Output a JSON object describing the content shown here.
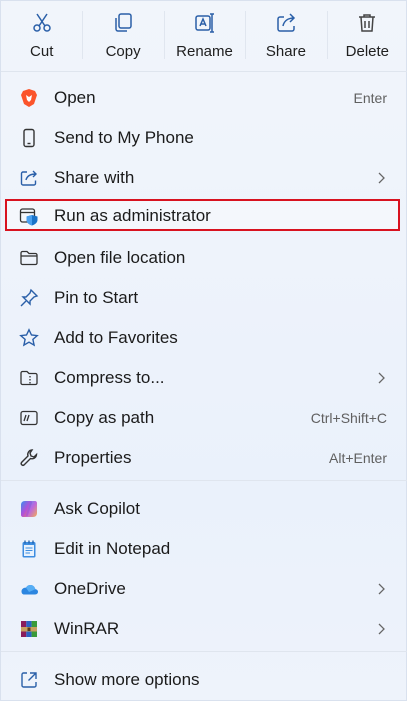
{
  "toolbar": {
    "cut": "Cut",
    "copy": "Copy",
    "rename": "Rename",
    "share": "Share",
    "delete": "Delete"
  },
  "items": {
    "open": {
      "label": "Open",
      "shortcut": "Enter"
    },
    "send_to_phone": {
      "label": "Send to My Phone"
    },
    "share_with": {
      "label": "Share with"
    },
    "run_as_admin": {
      "label": "Run as administrator"
    },
    "open_file_location": {
      "label": "Open file location"
    },
    "pin_to_start": {
      "label": "Pin to Start"
    },
    "add_to_favorites": {
      "label": "Add to Favorites"
    },
    "compress_to": {
      "label": "Compress to..."
    },
    "copy_as_path": {
      "label": "Copy as path",
      "shortcut": "Ctrl+Shift+C"
    },
    "properties": {
      "label": "Properties",
      "shortcut": "Alt+Enter"
    },
    "ask_copilot": {
      "label": "Ask Copilot"
    },
    "edit_in_notepad": {
      "label": "Edit in Notepad"
    },
    "onedrive": {
      "label": "OneDrive"
    },
    "winrar": {
      "label": "WinRAR"
    },
    "show_more_options": {
      "label": "Show more options"
    }
  },
  "colors": {
    "highlight_border": "#d8121f",
    "accent_blue": "#1a73c9",
    "brave_orange": "#fb542b"
  },
  "icons": [
    "cut-icon",
    "copy-icon",
    "rename-icon",
    "share-icon",
    "delete-icon",
    "brave-icon",
    "phone-icon",
    "share-with-icon",
    "admin-shield-icon",
    "folder-icon",
    "pin-icon",
    "star-icon",
    "compress-icon",
    "copy-path-icon",
    "wrench-icon",
    "copilot-icon",
    "notepad-icon",
    "onedrive-icon",
    "winrar-icon",
    "show-more-icon",
    "chevron-right-icon"
  ]
}
